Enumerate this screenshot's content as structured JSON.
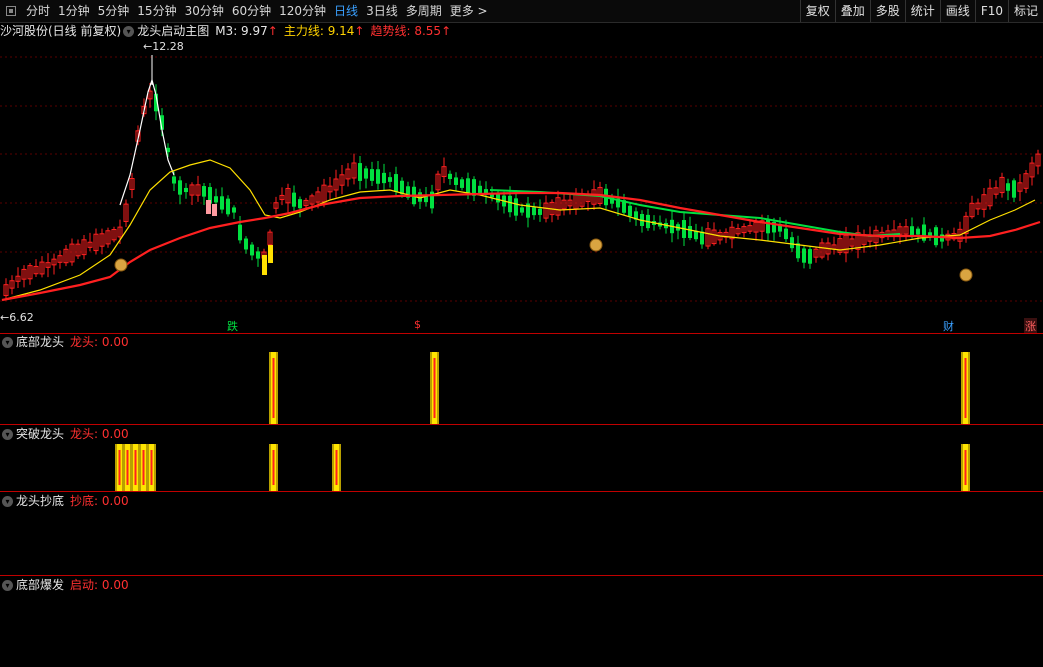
{
  "toolbar": {
    "periods": [
      "分时",
      "1分钟",
      "5分钟",
      "15分钟",
      "30分钟",
      "60分钟",
      "120分钟",
      "日线",
      "3日线",
      "多周期",
      "更多 >"
    ],
    "active_period": "日线",
    "right_buttons": [
      "复权",
      "叠加",
      "多股",
      "统计",
      "画线",
      "F10",
      "标记"
    ]
  },
  "main_chart": {
    "stock_title": "沙河股份(日线 前复权)",
    "indicator_name": "龙头启动主图",
    "m3_label": "M3: 9.97",
    "main_line_label": "主力线: 9.14",
    "trend_line_label": "趋势线: 8.55",
    "high_price_label": "12.28",
    "low_price_label": "6.62",
    "markers": {
      "die": "跌",
      "dollar": "$",
      "cai": "财",
      "zhang": "涨"
    },
    "colors": {
      "up": "#ff2020",
      "down": "#00e040",
      "m3": "#ffffff",
      "main_line": "#ffe000",
      "trend_line": "#ff2020",
      "green_line": "#00e040"
    }
  },
  "sub_panels": [
    {
      "title": "底部龙头",
      "indicator": "龙头: 0.00"
    },
    {
      "title": "突破龙头",
      "indicator": "龙头: 0.00"
    },
    {
      "title": "龙头抄底",
      "indicator": "抄底: 0.00"
    },
    {
      "title": "底部爆发",
      "indicator": "启动: 0.00"
    }
  ]
}
